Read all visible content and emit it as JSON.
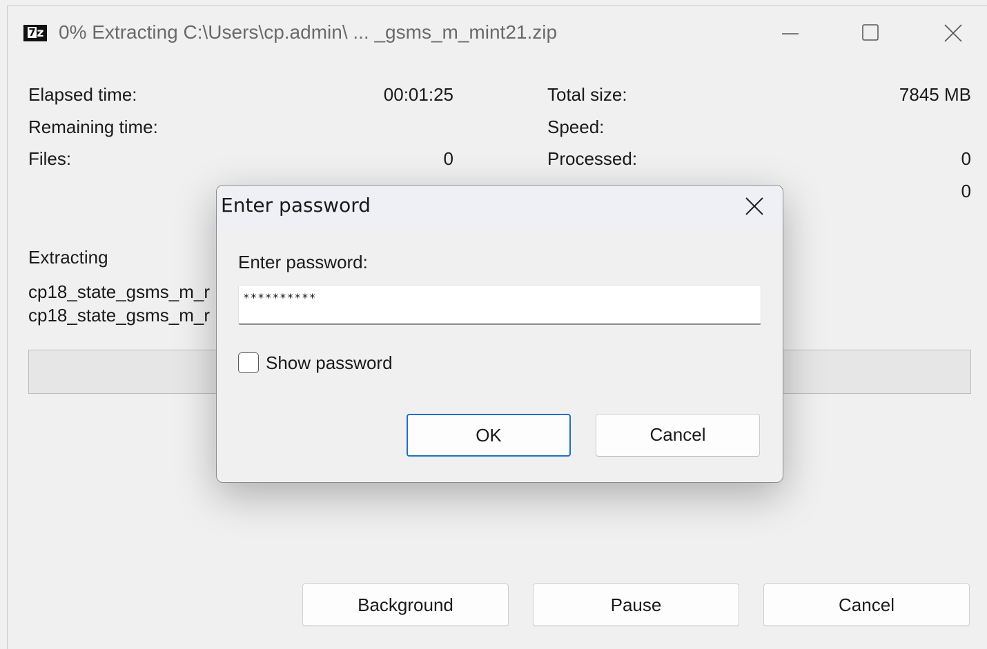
{
  "window": {
    "title": "0% Extracting C:\\Users\\cp.admin\\ ... _gsms_m_mint21.zip",
    "app_icon_text": "7z"
  },
  "stats": {
    "elapsed_label": "Elapsed time:",
    "elapsed_value": "00:01:25",
    "remaining_label": "Remaining time:",
    "remaining_value": "",
    "files_label": "Files:",
    "files_value": "0",
    "total_size_label": "Total size:",
    "total_size_value": "7845 MB",
    "speed_label": "Speed:",
    "speed_value": "",
    "processed_label": "Processed:",
    "processed_value": "0",
    "compressed_value": "0"
  },
  "extracting": {
    "label": "Extracting",
    "files": [
      "cp18_state_gsms_m_r",
      "cp18_state_gsms_m_r"
    ]
  },
  "progress": {
    "percent": 0
  },
  "buttons": {
    "background": "Background",
    "pause": "Pause",
    "cancel": "Cancel"
  },
  "dialog": {
    "title": "Enter password",
    "prompt": "Enter password:",
    "password_masked": "**********",
    "show_password_label": "Show password",
    "show_password_checked": false,
    "ok": "OK",
    "cancel": "Cancel"
  },
  "icons": {
    "minimize": "minimize-icon",
    "maximize": "maximize-icon",
    "close": "close-icon",
    "dialog_close": "close-icon"
  },
  "colors": {
    "window_bg": "#f0f0f0",
    "ok_border": "#1f6fc5",
    "title_text": "#6a6a6a"
  }
}
